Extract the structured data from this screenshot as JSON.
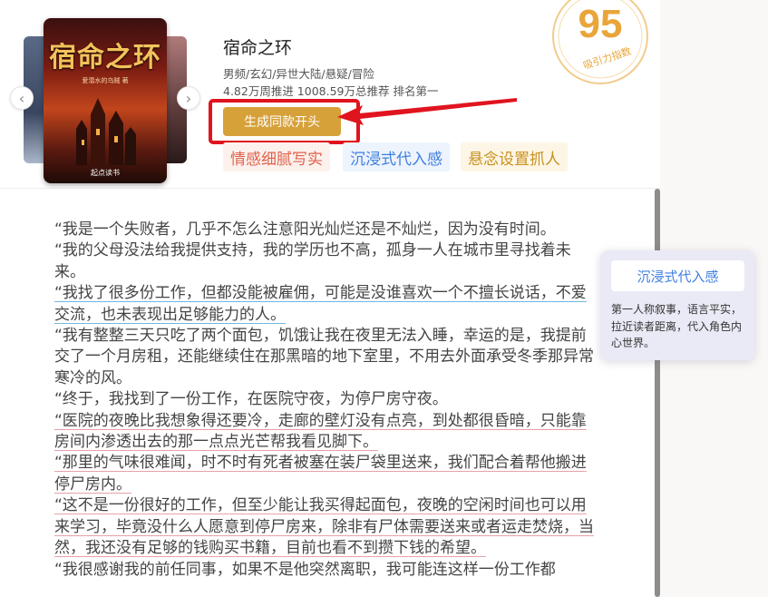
{
  "book": {
    "title": "宿命之环",
    "genre": "男频/玄幻/异世大陆/悬疑/冒险",
    "stats": "4.82万周推进 1008.59万总推荐 排名第一",
    "cover_title": "宿命之环",
    "cover_author": "爱潜水的乌贼 著",
    "cover_publisher": "起点读书"
  },
  "score": {
    "value": "95",
    "label": "吸引力指数",
    "color": "#e9a53a"
  },
  "actions": {
    "generate_label": "生成同款开头",
    "highlight_color": "#e0141f"
  },
  "tags": [
    "情感细腻写实",
    "沉浸式代入感",
    "悬念设置抓人"
  ],
  "tooltip": {
    "title": "沉浸式代入感",
    "description": "第一人称叙事，语言平实，拉近读者距离，代入角色内心世界。"
  },
  "paragraphs": [
    "“我是一个失败者，几乎不怎么注意阳光灿烂还是不灿烂，因为没有时间。",
    "“我的父母没法给我提供支持，我的学历也不高，孤身一人在城市里寻找着未来。",
    "“我找了很多份工作，但都没能被雇佣，可能是没谁喜欢一个不擅长说话，不爱交流，也未表现出足够能力的人。",
    "“我有整整三天只吃了两个面包，饥饿让我在夜里无法入睡，幸运的是，我提前交了一个月房租，还能继续住在那黑暗的地下室里，不用去外面承受冬季那异常寒冷的风。",
    "“终于，我找到了一份工作，在医院守夜，为停尸房守夜。",
    "“医院的夜晚比我想象得还要冷，走廊的壁灯没有点亮，到处都很昏暗，只能靠房间内渗透出去的那一点点光芒帮我看见脚下。",
    "“那里的气味很难闻，时不时有死者被塞在装尸袋里送来，我们配合着帮他搬进停尸房内。",
    "“这不是一份很好的工作，但至少能让我买得起面包，夜晚的空闲时间也可以用来学习，毕竟没什么人愿意到停尸房来，除非有尸体需要送来或者运走焚烧，当然，我还没有足够的钱购买书籍，目前也看不到攒下钱的希望。",
    "“我很感谢我的前任同事，如果不是他突然离职，我可能连这样一份工作都"
  ]
}
